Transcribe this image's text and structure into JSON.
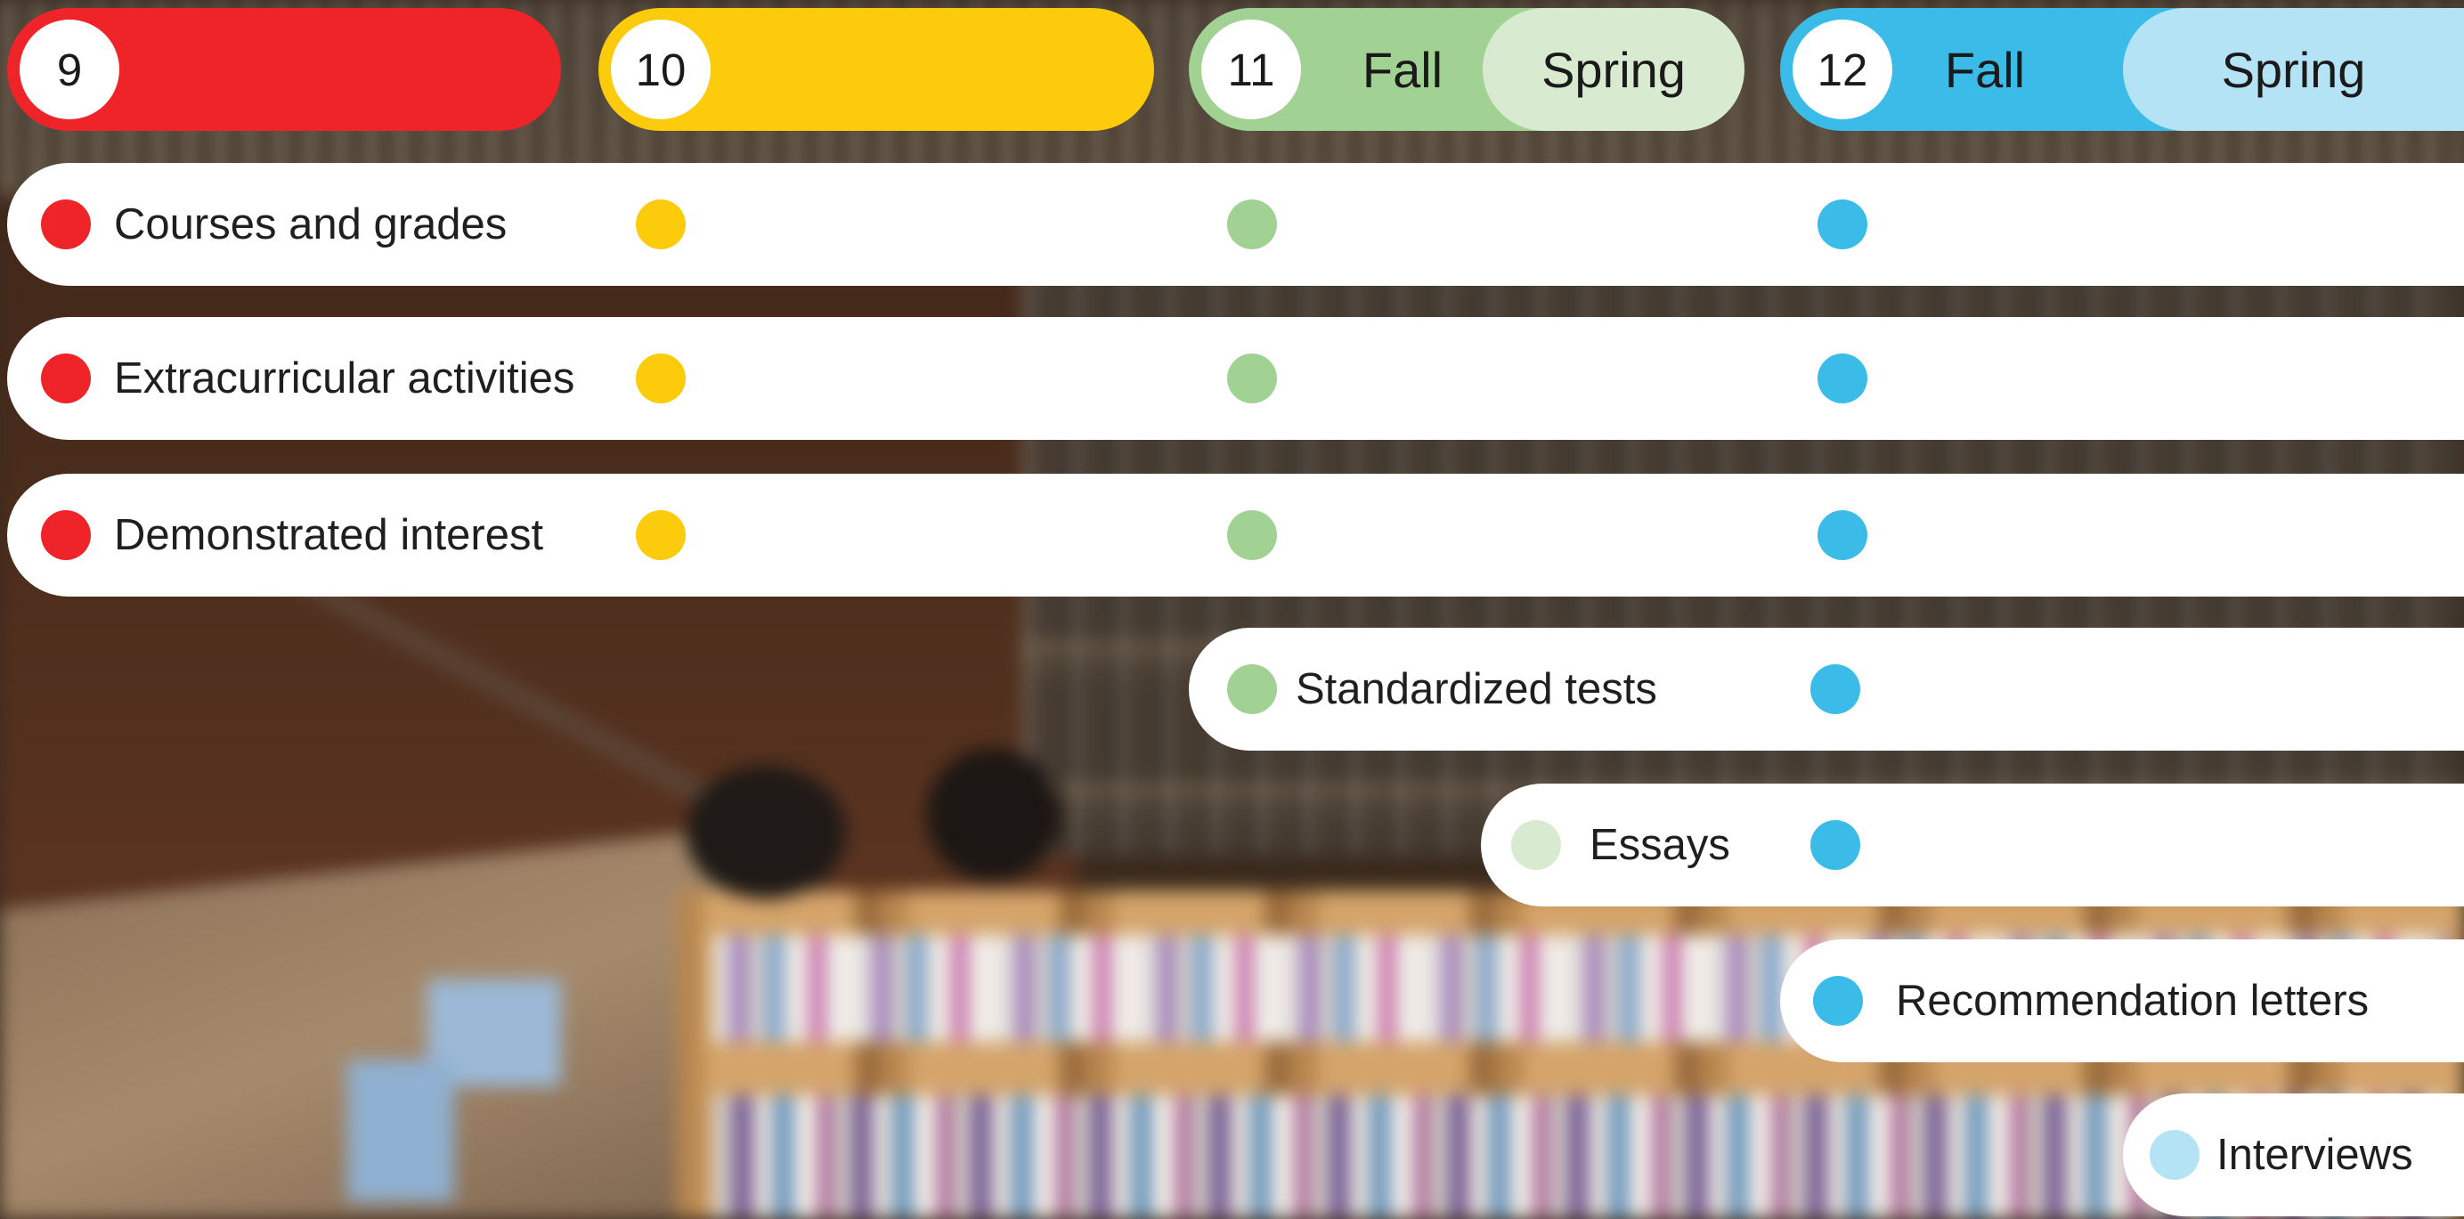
{
  "colors": {
    "grade_9": "#ee2428",
    "grade_10": "#fccb0b",
    "grade_11": "#a2d293",
    "grade_11_spring": "#d8ebd0",
    "grade_12": "#3bbce8",
    "grade_12_spring": "#b5e3f6",
    "row_background": "#ffffff"
  },
  "grades": [
    {
      "number": "9",
      "color": "#ee2428",
      "semesters": []
    },
    {
      "number": "10",
      "color": "#fccb0b",
      "semesters": []
    },
    {
      "number": "11",
      "color": "#a2d293",
      "semesters": [
        {
          "label": "Fall",
          "color": "#a2d293"
        },
        {
          "label": "Spring",
          "color": "#d8ebd0"
        }
      ]
    },
    {
      "number": "12",
      "color": "#3bbce8",
      "semesters": [
        {
          "label": "Fall",
          "color": "#3bbce8"
        },
        {
          "label": "Spring",
          "color": "#b5e3f6"
        }
      ]
    }
  ],
  "factors": [
    {
      "label": "Courses and grades",
      "starts": "9",
      "dots": [
        "9",
        "10",
        "11",
        "12"
      ]
    },
    {
      "label": "Extracurricular activities",
      "starts": "9",
      "dots": [
        "9",
        "10",
        "11",
        "12"
      ]
    },
    {
      "label": "Demonstrated interest",
      "starts": "9",
      "dots": [
        "9",
        "10",
        "11",
        "12"
      ]
    },
    {
      "label": "Standardized tests",
      "starts": "11",
      "dots": [
        "11",
        "12"
      ]
    },
    {
      "label": "Essays",
      "starts": "11 Spring",
      "dots": [
        "11 Spring",
        "12"
      ]
    },
    {
      "label": "Recommendation letters",
      "starts": "12",
      "dots": [
        "12"
      ]
    },
    {
      "label": "Interviews",
      "starts": "12 Spring",
      "dots": [
        "12 Spring"
      ]
    }
  ]
}
